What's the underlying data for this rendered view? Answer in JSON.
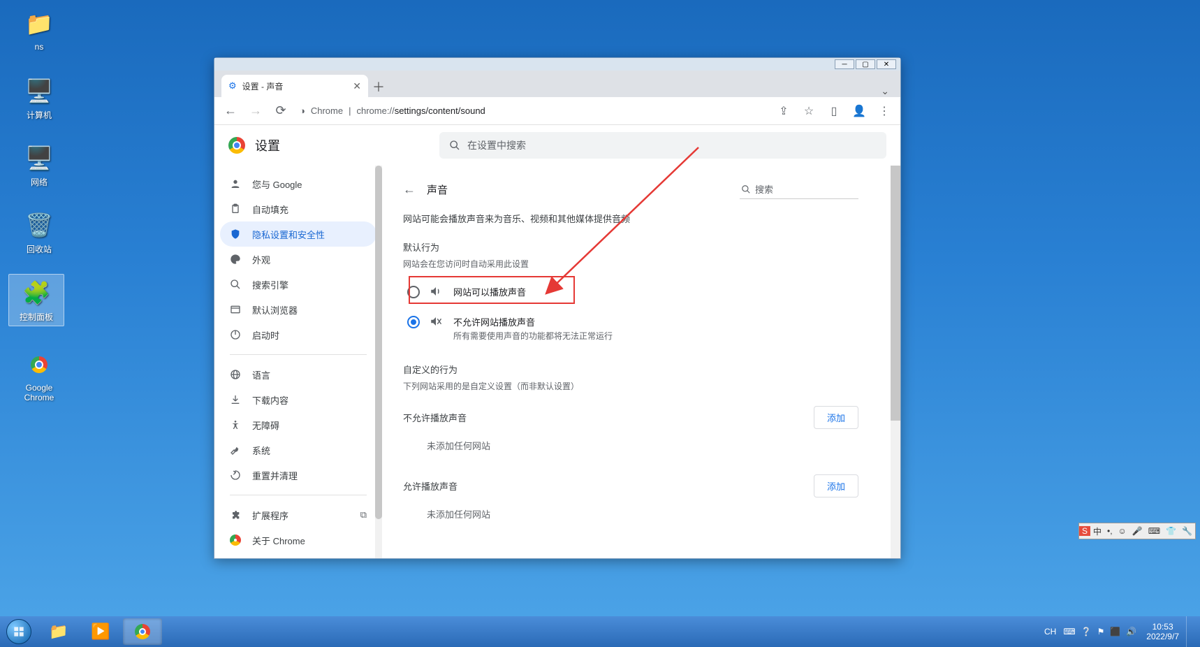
{
  "desktop": {
    "icons": [
      {
        "label": "ns",
        "glyph": "📁"
      },
      {
        "label": "计算机",
        "glyph": "🖥️"
      },
      {
        "label": "网络",
        "glyph": "🌐"
      },
      {
        "label": "回收站",
        "glyph": "🗑️"
      },
      {
        "label": "控制面板",
        "glyph": "⚙️"
      },
      {
        "label": "Google Chrome",
        "glyph": "◉"
      }
    ]
  },
  "taskbar": {
    "time": "10:53",
    "date": "2022/9/7",
    "tray_ch": "CH"
  },
  "ime": {
    "ch": "中"
  },
  "window": {
    "tab_title": "设置 - 声音",
    "url_prefix": "Chrome",
    "url_sep": "|",
    "url_gray": "chrome://",
    "url_dark": "settings/content/sound"
  },
  "settings": {
    "title": "设置",
    "search_placeholder": "在设置中搜索",
    "sidebar": [
      {
        "icon": "person",
        "label": "您与 Google"
      },
      {
        "icon": "clipboard",
        "label": "自动填充"
      },
      {
        "icon": "shield",
        "label": "隐私设置和安全性",
        "selected": true
      },
      {
        "icon": "palette",
        "label": "外观"
      },
      {
        "icon": "search",
        "label": "搜索引擎"
      },
      {
        "icon": "browser",
        "label": "默认浏览器"
      },
      {
        "icon": "power",
        "label": "启动时"
      },
      {
        "sep": true
      },
      {
        "icon": "globe",
        "label": "语言"
      },
      {
        "icon": "download",
        "label": "下载内容"
      },
      {
        "icon": "access",
        "label": "无障碍"
      },
      {
        "icon": "wrench",
        "label": "系统"
      },
      {
        "icon": "reset",
        "label": "重置并清理"
      },
      {
        "sep": true
      },
      {
        "icon": "puzzle",
        "label": "扩展程序",
        "ext": true
      },
      {
        "icon": "chrome",
        "label": "关于 Chrome"
      }
    ],
    "page": {
      "back_title": "声音",
      "inpage_search": "搜索",
      "desc": "网站可能会播放声音来为音乐、视频和其他媒体提供音频",
      "default_label": "默认行为",
      "default_sub": "网站会在您访问时自动采用此设置",
      "opt1": "网站可以播放声音",
      "opt2_title": "不允许网站播放声音",
      "opt2_sub": "所有需要使用声音的功能都将无法正常运行",
      "custom_label": "自定义的行为",
      "custom_sub": "下列网站采用的是自定义设置（而非默认设置）",
      "block_head": "不允许播放声音",
      "allow_head": "允许播放声音",
      "add_btn": "添加",
      "empty": "未添加任何网站"
    }
  }
}
